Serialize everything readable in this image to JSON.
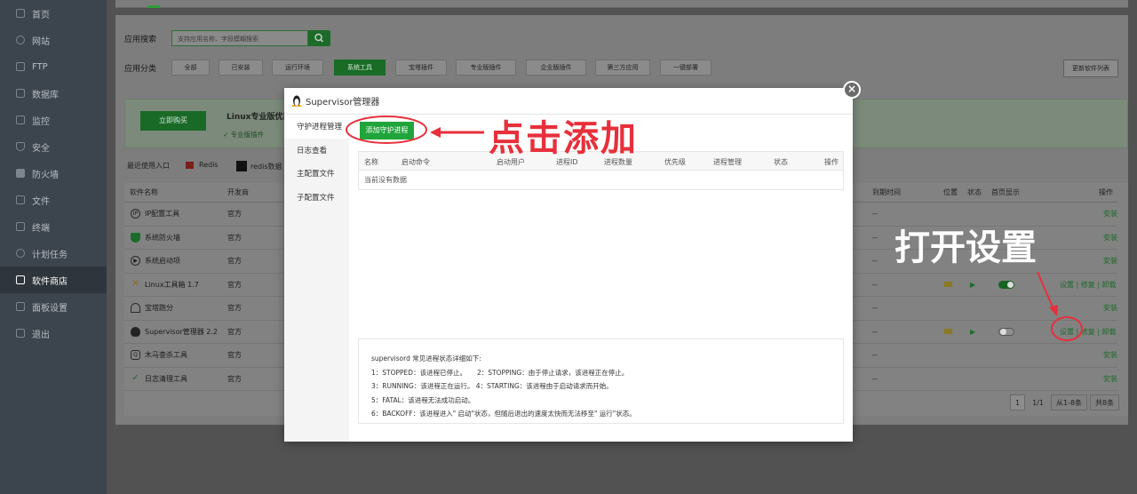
{
  "sidebar": {
    "items": [
      {
        "label": "首页",
        "icon": "home-icon"
      },
      {
        "label": "网站",
        "icon": "globe-icon"
      },
      {
        "label": "FTP",
        "icon": "ftp-icon"
      },
      {
        "label": "数据库",
        "icon": "database-icon"
      },
      {
        "label": "监控",
        "icon": "monitor-icon"
      },
      {
        "label": "安全",
        "icon": "shield-icon"
      },
      {
        "label": "防火墙",
        "icon": "firewall-icon"
      },
      {
        "label": "文件",
        "icon": "folder-icon"
      },
      {
        "label": "终端",
        "icon": "terminal-icon"
      },
      {
        "label": "计划任务",
        "icon": "clock-icon"
      },
      {
        "label": "软件商店",
        "icon": "grid-icon"
      },
      {
        "label": "面板设置",
        "icon": "settings-icon"
      },
      {
        "label": "退出",
        "icon": "logout-icon"
      }
    ],
    "active": "软件商店"
  },
  "store": {
    "search_label": "应用搜索",
    "search_placeholder": "支持应用名称、字段模糊搜索",
    "category_label": "应用分类",
    "categories": [
      "全部",
      "已安装",
      "运行环境",
      "系统工具",
      "宝塔插件",
      "专业版插件",
      "企业版插件",
      "第三方应用",
      "一键部署"
    ],
    "active_category": "系统工具",
    "update_button": "更新软件列表",
    "promo": {
      "buy_button": "立即购买",
      "title": "Linux专业版优惠",
      "subtitle": "✓ 专业版插件"
    },
    "recent": {
      "label": "最近使用入口",
      "items": [
        "Redis",
        "redis数据"
      ]
    },
    "table": {
      "headers": [
        "软件名称",
        "开发商",
        "到期时间",
        "位置",
        "状态",
        "首页显示",
        "操作"
      ],
      "rows": [
        {
          "name": "IP配置工具",
          "dev": "官方",
          "expire": "--",
          "ops": "安装"
        },
        {
          "name": "系统防火墙",
          "dev": "官方",
          "expire": "--",
          "ops": "安装"
        },
        {
          "name": "系统启动项",
          "dev": "官方",
          "expire": "--",
          "ops": "安装"
        },
        {
          "name": "Linux工具箱 1.7",
          "dev": "官方",
          "expire": "--",
          "ops": "设置 | 修复 | 卸载"
        },
        {
          "name": "宝塔跑分",
          "dev": "官方",
          "expire": "--",
          "ops": "安装"
        },
        {
          "name": "Supervisor管理器 2.2",
          "dev": "官方",
          "expire": "--",
          "ops": "设置 | 修复 | 卸载"
        },
        {
          "name": "木马查杀工具",
          "dev": "官方",
          "expire": "--",
          "ops": "安装"
        },
        {
          "name": "日志清理工具",
          "dev": "官方",
          "expire": "--",
          "ops": "安装"
        }
      ]
    },
    "pager": {
      "current": "1",
      "pages": "1/1",
      "range": "从1-8条",
      "total": "共8条"
    }
  },
  "modal": {
    "title": "Supervisor管理器",
    "close": "×",
    "menu": [
      "守护进程管理",
      "日志查看",
      "主配置文件",
      "子配置文件"
    ],
    "add_button": "添加守护进程",
    "table_headers": [
      "名称",
      "启动命令",
      "启动用户",
      "进程ID",
      "进程数量",
      "优先级",
      "进程管理",
      "状态",
      "操作"
    ],
    "empty_text": "当前没有数据",
    "info_lines": [
      "supervisord 常见进程状态详细如下:",
      "1：STOPPED：该进程已停止。     2：STOPPING：由于停止请求，该进程正在停止。",
      "3：RUNNING：该进程正在运行。 4：STARTING：该进程由于启动请求而开始。",
      "5：FATAL：该进程无法成功启动。",
      "6：BACKOFF：该进程进入\" 启动\"状态，但随后退出的速度太快而无法移至\" 运行\"状态。"
    ]
  },
  "annotations": {
    "click_add": "点击添加",
    "open_settings": "打开设置",
    "color": "#e7303b"
  }
}
